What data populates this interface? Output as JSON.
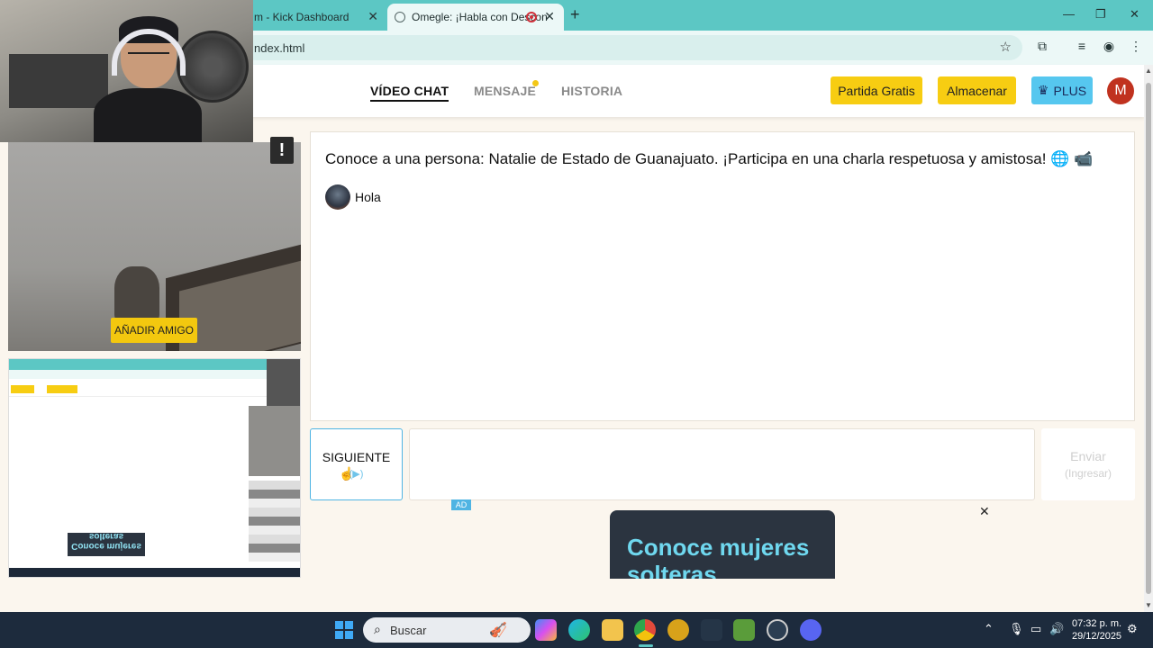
{
  "browser": {
    "tabs": [
      {
        "label": "m - Kick Dashboard",
        "close": "✕"
      },
      {
        "label": "Omegle: ¡Habla con Descon",
        "close": "✕"
      }
    ],
    "new_tab": "+",
    "url": "ndex.html",
    "window": {
      "minimize": "—",
      "maximize": "❐",
      "close": "✕"
    }
  },
  "header": {
    "nav": [
      {
        "label": "VÍDEO CHAT",
        "active": true
      },
      {
        "label": "MENSAJE",
        "active": false,
        "has_notification_dot": true
      },
      {
        "label": "HISTORIA",
        "active": false
      }
    ],
    "buttons": {
      "free_match": "Partida Gratis",
      "store": "Almacenar",
      "plus": "PLUS",
      "plus_icon": "♛"
    },
    "avatar_letter": "M",
    "colors": {
      "yellow": "#f7cd12",
      "blue": "#56c7ef",
      "avatar": "#c0321f"
    }
  },
  "video": {
    "report_label": "!",
    "add_friend": "AÑADIR AMIGO"
  },
  "selfview_ad": "Conoce mujeres solteras",
  "chat": {
    "intro": "Conoce a una persona: Natalie de Estado de Guanajuato. ¡Participa en una charla respetuosa y amistosa! 🌐 📹",
    "messages": [
      {
        "text": "Hola"
      }
    ]
  },
  "controls": {
    "next": {
      "label": "SIGUIENTE",
      "sub": "(▶)"
    },
    "message_placeholder": "",
    "send": {
      "label": "Enviar",
      "sub": "(Ingresar)"
    }
  },
  "ad": {
    "badge": "AD",
    "text": "Conoce mujeres solteras",
    "close": "✕"
  },
  "taskbar": {
    "search_placeholder": "Buscar",
    "time": "07:32 p. m.",
    "date": "29/12/2025"
  }
}
